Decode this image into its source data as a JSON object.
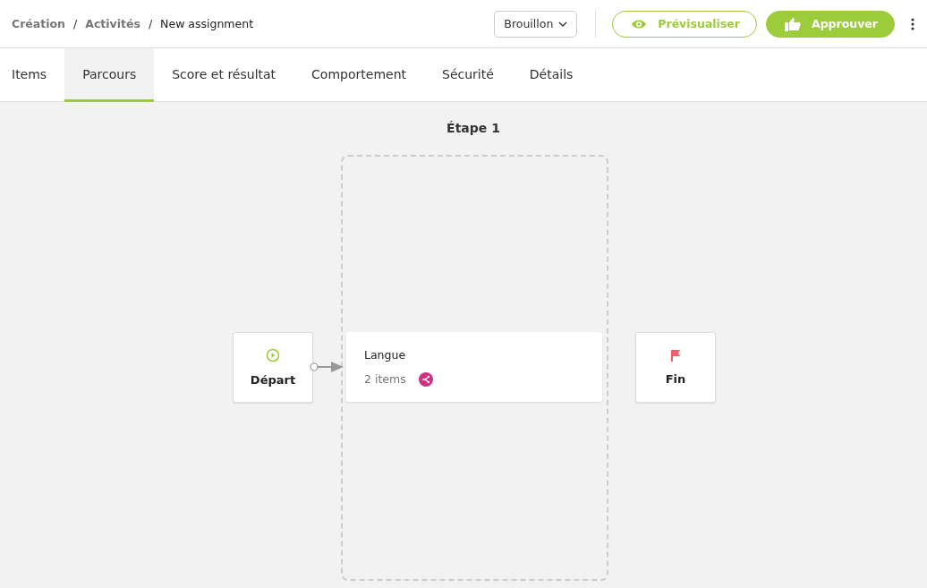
{
  "breadcrumb": [
    {
      "label": "Création",
      "current": false
    },
    {
      "label": "Activités",
      "current": false
    },
    {
      "label": "New assignment",
      "current": true
    }
  ],
  "breadcrumb_separator": "/",
  "status_dropdown": {
    "value": "Brouillon"
  },
  "buttons": [
    {
      "label": "Prévisualiser",
      "kind": "outline"
    },
    {
      "label": "Approuver",
      "kind": "filled"
    }
  ],
  "tabs": [
    {
      "label": "Items",
      "selected": false
    },
    {
      "label": "Parcours",
      "selected": true
    },
    {
      "label": "Score et résultat",
      "selected": false
    },
    {
      "label": "Comportement",
      "selected": false
    },
    {
      "label": "Sécurité",
      "selected": false
    },
    {
      "label": "Détails",
      "selected": false
    }
  ],
  "stage": {
    "title": "Étape 1"
  },
  "start_node": {
    "label": "Départ"
  },
  "section_card": {
    "title": "Langue",
    "count": "2 items"
  },
  "end_node": {
    "label": "Fin"
  }
}
